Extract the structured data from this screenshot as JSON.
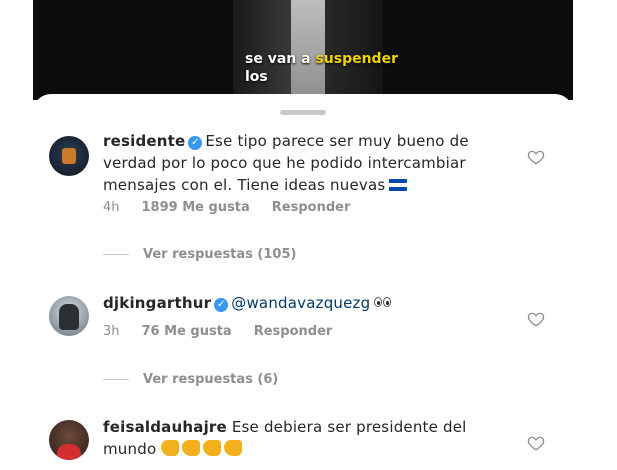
{
  "video": {
    "caption_line1_a": "se van a ",
    "caption_line1_b": "suspender",
    "caption_line2": "los"
  },
  "comments": [
    {
      "username": "residente",
      "text": "Ese tipo parece ser muy bueno de verdad por lo poco que he podido intercambiar mensajes con el. Tiene ideas nuevas",
      "time": "4h",
      "likes": "1899 Me gusta",
      "reply": "Responder",
      "replies": "Ver respuestas (105)"
    },
    {
      "username": "djkingarthur",
      "mention": "@wandavazquezg",
      "time": "3h",
      "likes": "76 Me gusta",
      "reply": "Responder",
      "replies": "Ver respuestas (6)"
    },
    {
      "username": "feisaldauhajre",
      "text": "Ese debiera ser presidente del mundo"
    }
  ],
  "colors": {
    "verified": "#3897f0",
    "mention": "#00376b",
    "meta": "#8e8e8e",
    "highlight": "#f0d400"
  }
}
